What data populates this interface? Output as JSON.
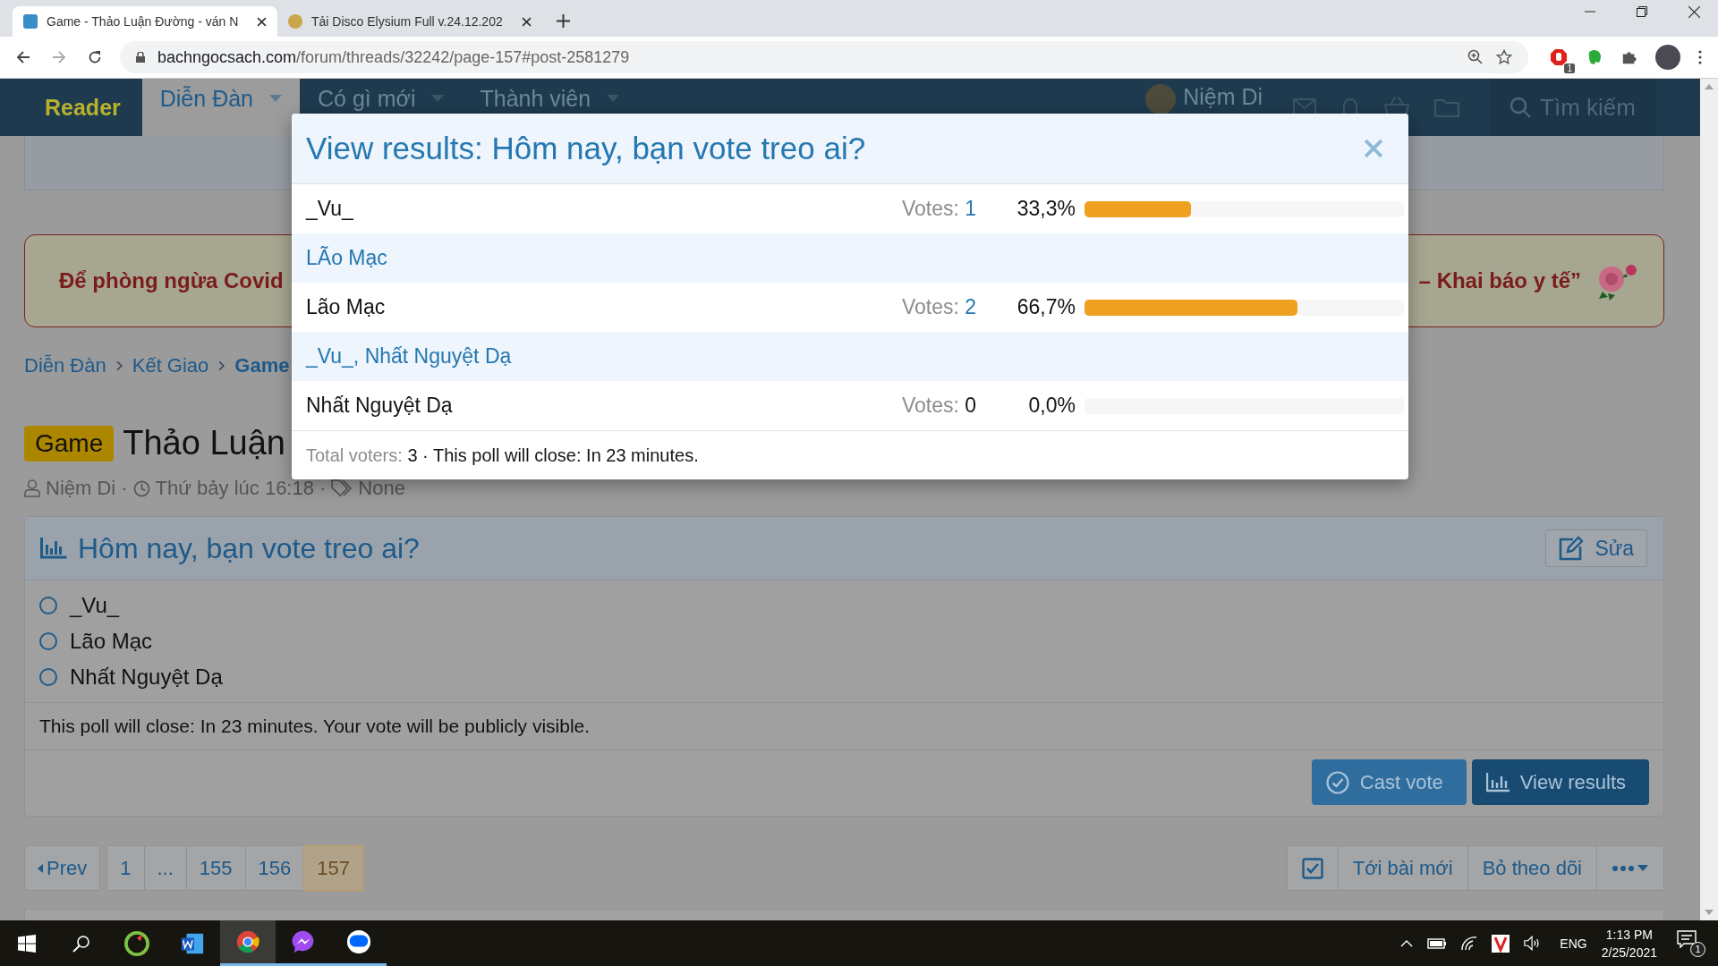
{
  "browser": {
    "tabs": [
      {
        "title": "Game - Thảo Luận Đường - ván N",
        "selected": true
      },
      {
        "title": "Tải Disco Elysium Full v.24.12.202",
        "selected": false
      }
    ],
    "url_host": "bachngocsach.com",
    "url_path": "/forum/threads/32242/page-157#post-2581279",
    "extension_badge": "1"
  },
  "site_nav": {
    "brand": "Reader",
    "items": [
      {
        "label": "Diễn Đàn",
        "selected": true
      },
      {
        "label": "Có gì mới",
        "selected": false
      },
      {
        "label": "Thành viên",
        "selected": false
      }
    ],
    "user": "Niệm Di",
    "search": "Tìm kiếm"
  },
  "banner": {
    "left": "Để phòng ngừa Covid",
    "right": "– Khai báo y tế”"
  },
  "breadcrumb": [
    {
      "label": "Diễn Đàn",
      "current": false
    },
    {
      "label": "Kết Giao",
      "current": false
    },
    {
      "label": "Game",
      "current": true
    }
  ],
  "thread": {
    "prefix": "Game",
    "title": "Thảo Luận",
    "author": "Niệm Di",
    "separators": [
      "·",
      "·"
    ],
    "time": "Thứ bảy lúc 16:18",
    "tags": "None"
  },
  "poll": {
    "question": "Hôm nay, bạn vote treo ai?",
    "edit": "Sửa",
    "options": [
      {
        "label": "_Vu_",
        "selected": false
      },
      {
        "label": "Lão Mạc",
        "selected": false
      },
      {
        "label": "Nhất Nguyệt Dạ",
        "selected": false
      }
    ],
    "note": "This poll will close: In 23 minutes. Your vote will be publicly visible.",
    "buttons": [
      {
        "label": "Cast vote",
        "kind": "check"
      },
      {
        "label": "View results",
        "kind": "chart"
      }
    ]
  },
  "pagination": {
    "prev": "Prev",
    "pages": [
      {
        "label": "1",
        "selected": false
      },
      {
        "label": "...",
        "selected": false
      },
      {
        "label": "155",
        "selected": false
      },
      {
        "label": "156",
        "selected": false
      },
      {
        "label": "157",
        "selected": true
      }
    ]
  },
  "thread_actions": {
    "watch_checked": true,
    "items": [
      "Tới bài mới",
      "Bỏ theo dõi"
    ]
  },
  "modal": {
    "title": "View results: Hôm nay, bạn vote treo ai?",
    "results": [
      {
        "option": "_Vu_",
        "votes_label": "Votes:",
        "votes": "1",
        "percent": "33,3%",
        "level": 0.333,
        "voters": "LÃo Mạc"
      },
      {
        "option": "Lão Mạc",
        "votes_label": "Votes:",
        "votes": "2",
        "percent": "66,7%",
        "level": 0.667,
        "voters": "_Vu_, Nhất Nguyệt Dạ"
      },
      {
        "option": "Nhất Nguyệt Dạ",
        "votes_label": "Votes:",
        "votes": "0",
        "percent": "0,0%"
      }
    ],
    "footer_label": "Total voters:",
    "footer_count": "3",
    "footer_note": "· This poll will close: In 23 minutes."
  },
  "taskbar": {
    "apps": [
      {
        "kind": "ccleaner",
        "selected": false,
        "running": false
      },
      {
        "kind": "word",
        "selected": false,
        "running": false
      },
      {
        "kind": "chrome",
        "selected": true,
        "running": true
      },
      {
        "kind": "messenger",
        "selected": false,
        "running": true
      },
      {
        "kind": "zalo",
        "selected": false,
        "running": true
      }
    ],
    "lang": "ENG",
    "time": "1:13 PM",
    "date": "2/25/2021",
    "notification_count": "1"
  }
}
